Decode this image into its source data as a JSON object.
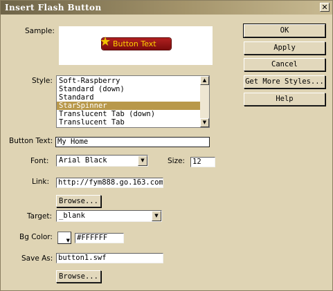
{
  "window": {
    "title": "Insert Flash Button",
    "close_glyph": "✕"
  },
  "labels": {
    "sample": "Sample:",
    "style": "Style:",
    "button_text": "Button Text:",
    "font": "Font:",
    "size": "Size:",
    "link": "Link:",
    "target": "Target:",
    "bg_color": "Bg Color:",
    "save_as": "Save As:"
  },
  "sample": {
    "button_text": "Button Text",
    "star_icon": "star-icon",
    "star_glyph": "★"
  },
  "style_list": {
    "items": [
      "Soft-Raspberry",
      "Standard (down)",
      "Standard",
      "StarSpinner",
      "Translucent Tab (down)",
      "Translucent Tab"
    ],
    "selected": "StarSpinner"
  },
  "fields": {
    "button_text": "My Home",
    "font": "Arial Black",
    "size": "12",
    "link": "http://fym888.go.163.com",
    "target": "_blank",
    "bg_color": "#FFFFFF",
    "save_as": "button1.swf"
  },
  "buttons": {
    "browse_link": "Browse...",
    "browse_save": "Browse...",
    "ok": "OK",
    "apply": "Apply",
    "cancel": "Cancel",
    "get_more_styles": "Get More Styles...",
    "help": "Help"
  },
  "glyphs": {
    "arrow_up": "▲",
    "arrow_down": "▼"
  },
  "colors": {
    "titlebar_start": "#6e6448",
    "dialog_bg": "#dfd4b4",
    "selection": "#b8984a",
    "flash_button": "#9a1818",
    "flash_text": "#ffd200"
  }
}
